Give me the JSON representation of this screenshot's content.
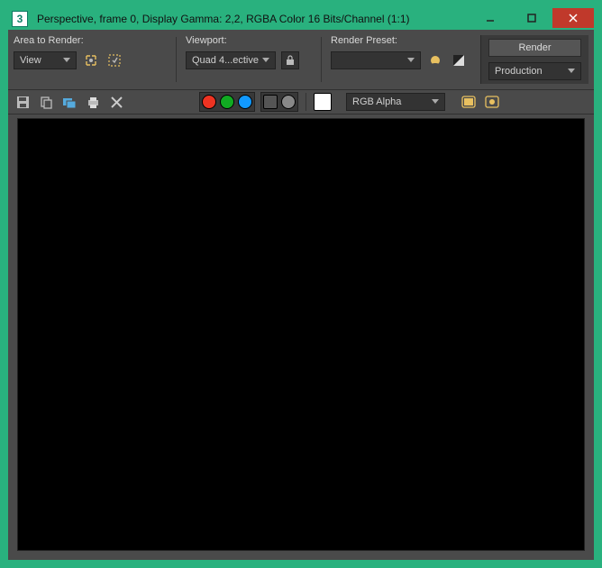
{
  "titlebar": {
    "app_icon_text": "3",
    "title": "Perspective, frame 0, Display Gamma: 2,2, RGBA Color 16 Bits/Channel (1:1)"
  },
  "toolbar": {
    "area_label": "Area to Render:",
    "area_value": "View",
    "viewport_label": "Viewport:",
    "viewport_value": "Quad 4...ective",
    "preset_label": "Render Preset:",
    "preset_value": "",
    "render_label": "Render",
    "prod_value": "Production"
  },
  "toolbar2": {
    "channel_value": "RGB Alpha"
  }
}
